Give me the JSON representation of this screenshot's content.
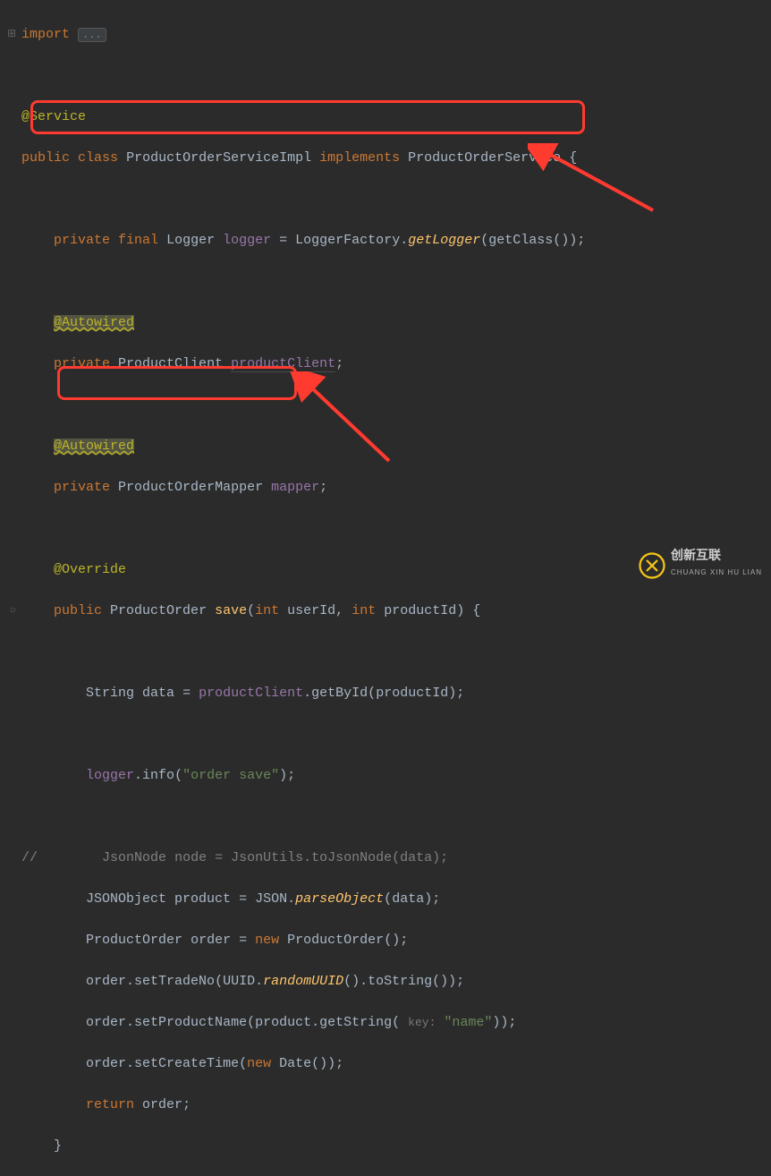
{
  "kw": {
    "import": "import",
    "public": "public",
    "class": "class",
    "implements": "implements",
    "private": "private",
    "final": "final",
    "int": "int",
    "new": "new",
    "return": "return"
  },
  "fold": "...",
  "ann": {
    "service": "@Service",
    "autowired": "@Autowired",
    "override": "@Override"
  },
  "types": {
    "cls": "ProductOrderServiceImpl",
    "iface": "ProductOrderService",
    "logger": "Logger",
    "loggerFactory": "LoggerFactory",
    "productClient": "ProductClient",
    "mapper": "ProductOrderMapper",
    "returnType": "ProductOrder",
    "string": "String",
    "jsonNode": "JsonNode",
    "jsonUtils": "JsonUtils",
    "jsonObject": "JSONObject",
    "json": "JSON",
    "uuid": "UUID",
    "date": "Date"
  },
  "fields": {
    "logger": "logger",
    "productClient": "productClient",
    "mapper": "mapper"
  },
  "vars": {
    "data": "data",
    "node": "node",
    "product": "product",
    "order": "order"
  },
  "methods": {
    "getLogger": "getLogger",
    "getClass": "getClass",
    "save": "save",
    "getById": "getById",
    "info": "info",
    "toJsonNode": "toJsonNode",
    "parseObject": "parseObject",
    "setTradeNo": "setTradeNo",
    "randomUUID": "randomUUID",
    "toString": "toString",
    "setProductName": "setProductName",
    "getString": "getString",
    "setCreateTime": "setCreateTime"
  },
  "params": {
    "userId": "userId",
    "productId": "productId"
  },
  "strings": {
    "orderSave": "\"order save\"",
    "name": "\"name\""
  },
  "hint": {
    "key": "key:"
  },
  "commentMarker": "//",
  "logo": {
    "main": "创新互联",
    "sub": "CHUANG XIN HU LIAN"
  }
}
